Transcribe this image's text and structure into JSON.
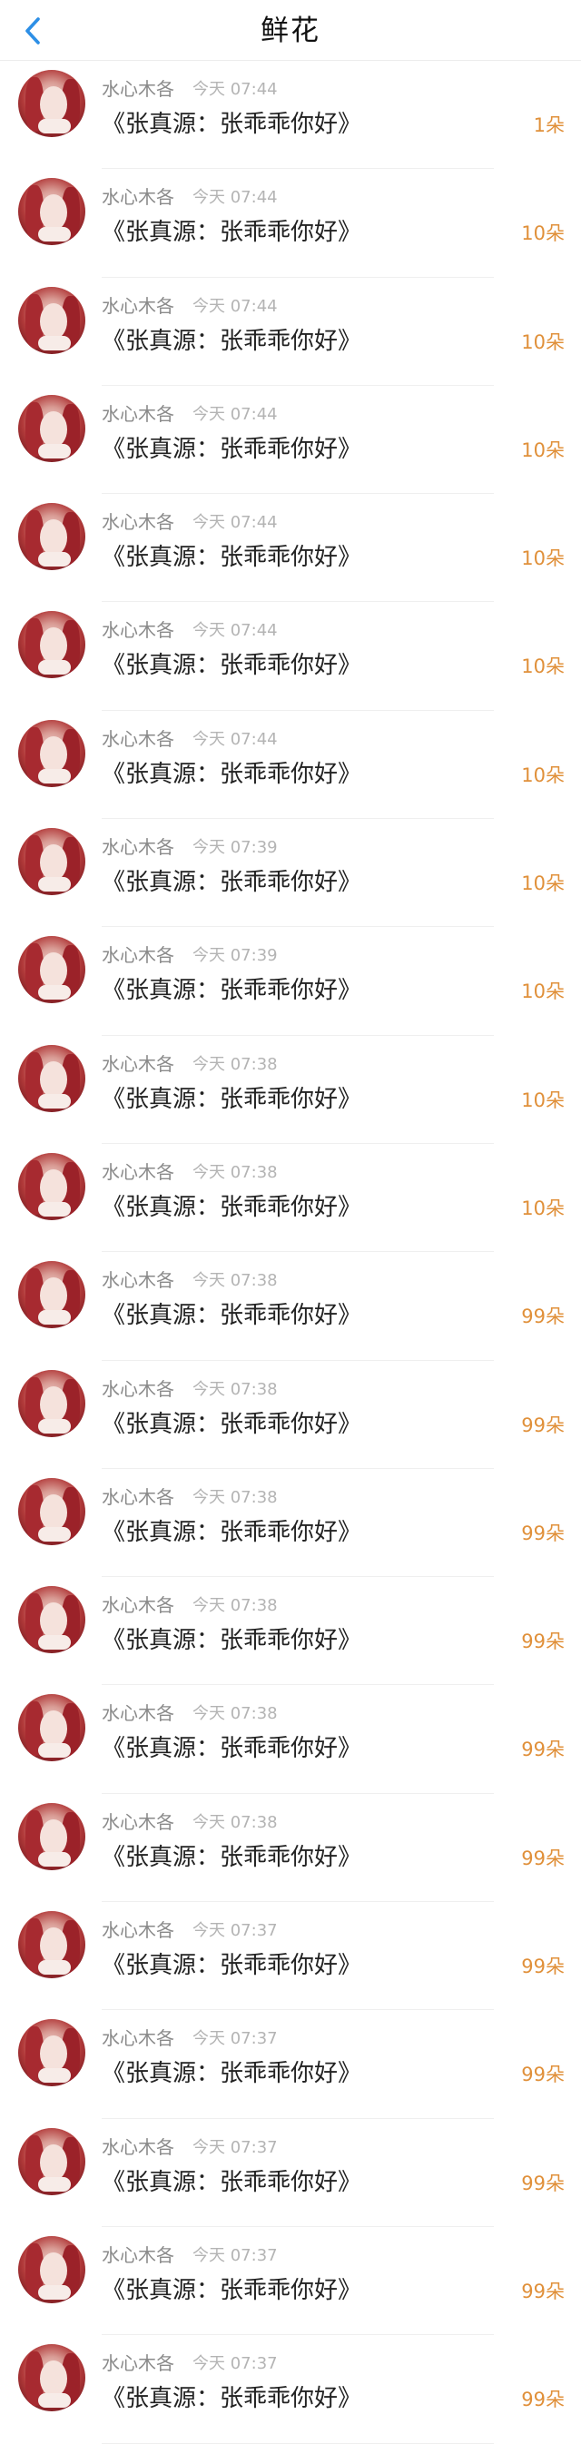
{
  "header": {
    "title": "鲜花",
    "back_icon": "chevron-left-icon",
    "accent_color": "#2d8fe6"
  },
  "gift_color": "#e0903a",
  "items": [
    {
      "name": "水心木各",
      "time": "今天 07:44",
      "message": "《张真源：张乖乖你好》",
      "count": "1朵"
    },
    {
      "name": "水心木各",
      "time": "今天 07:44",
      "message": "《张真源：张乖乖你好》",
      "count": "10朵"
    },
    {
      "name": "水心木各",
      "time": "今天 07:44",
      "message": "《张真源：张乖乖你好》",
      "count": "10朵"
    },
    {
      "name": "水心木各",
      "time": "今天 07:44",
      "message": "《张真源：张乖乖你好》",
      "count": "10朵"
    },
    {
      "name": "水心木各",
      "time": "今天 07:44",
      "message": "《张真源：张乖乖你好》",
      "count": "10朵"
    },
    {
      "name": "水心木各",
      "time": "今天 07:44",
      "message": "《张真源：张乖乖你好》",
      "count": "10朵"
    },
    {
      "name": "水心木各",
      "time": "今天 07:44",
      "message": "《张真源：张乖乖你好》",
      "count": "10朵"
    },
    {
      "name": "水心木各",
      "time": "今天 07:39",
      "message": "《张真源：张乖乖你好》",
      "count": "10朵"
    },
    {
      "name": "水心木各",
      "time": "今天 07:39",
      "message": "《张真源：张乖乖你好》",
      "count": "10朵"
    },
    {
      "name": "水心木各",
      "time": "今天 07:38",
      "message": "《张真源：张乖乖你好》",
      "count": "10朵"
    },
    {
      "name": "水心木各",
      "time": "今天 07:38",
      "message": "《张真源：张乖乖你好》",
      "count": "10朵"
    },
    {
      "name": "水心木各",
      "time": "今天 07:38",
      "message": "《张真源：张乖乖你好》",
      "count": "99朵"
    },
    {
      "name": "水心木各",
      "time": "今天 07:38",
      "message": "《张真源：张乖乖你好》",
      "count": "99朵"
    },
    {
      "name": "水心木各",
      "time": "今天 07:38",
      "message": "《张真源：张乖乖你好》",
      "count": "99朵"
    },
    {
      "name": "水心木各",
      "time": "今天 07:38",
      "message": "《张真源：张乖乖你好》",
      "count": "99朵"
    },
    {
      "name": "水心木各",
      "time": "今天 07:38",
      "message": "《张真源：张乖乖你好》",
      "count": "99朵"
    },
    {
      "name": "水心木各",
      "time": "今天 07:38",
      "message": "《张真源：张乖乖你好》",
      "count": "99朵"
    },
    {
      "name": "水心木各",
      "time": "今天 07:37",
      "message": "《张真源：张乖乖你好》",
      "count": "99朵"
    },
    {
      "name": "水心木各",
      "time": "今天 07:37",
      "message": "《张真源：张乖乖你好》",
      "count": "99朵"
    },
    {
      "name": "水心木各",
      "time": "今天 07:37",
      "message": "《张真源：张乖乖你好》",
      "count": "99朵"
    },
    {
      "name": "水心木各",
      "time": "今天 07:37",
      "message": "《张真源：张乖乖你好》",
      "count": "99朵"
    },
    {
      "name": "水心木各",
      "time": "今天 07:37",
      "message": "《张真源：张乖乖你好》",
      "count": "99朵"
    }
  ]
}
